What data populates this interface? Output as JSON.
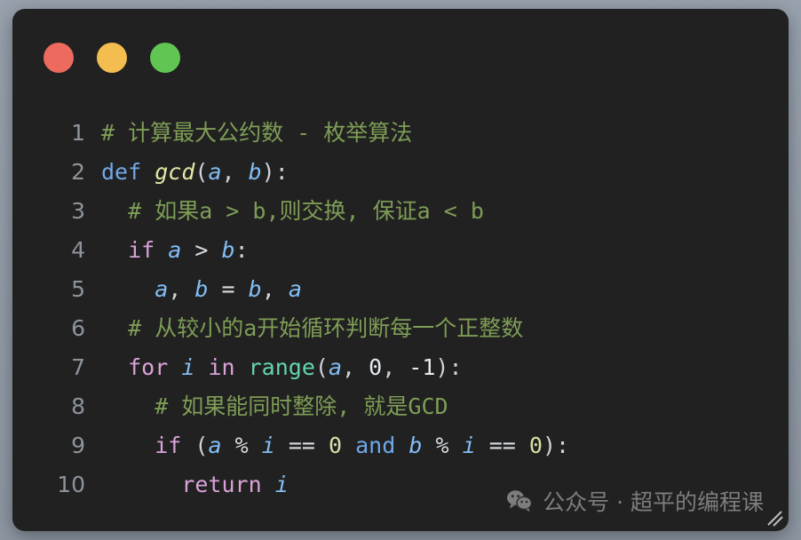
{
  "window": {
    "background_color": "#212121",
    "page_background_color": "#8b95a1",
    "traffic_lights": [
      {
        "name": "close",
        "color": "#ec6a5e"
      },
      {
        "name": "minimize",
        "color": "#f4bd4f"
      },
      {
        "name": "zoom",
        "color": "#61c554"
      }
    ]
  },
  "editor": {
    "language": "python",
    "line_number_color": "#8d949c",
    "lines": [
      {
        "num": "1",
        "text": "# 计算最大公约数 - 枚举算法"
      },
      {
        "num": "2",
        "text": "def gcd(a, b):"
      },
      {
        "num": "3",
        "text": "  # 如果a > b,则交换, 保证a < b"
      },
      {
        "num": "4",
        "text": "  if a > b:"
      },
      {
        "num": "5",
        "text": "    a, b = b, a"
      },
      {
        "num": "6",
        "text": "  # 从较小的a开始循环判断每一个正整数"
      },
      {
        "num": "7",
        "text": "  for i in range(a, 0, -1):"
      },
      {
        "num": "8",
        "text": "    # 如果能同时整除, 就是GCD"
      },
      {
        "num": "9",
        "text": "    if (a % i == 0 and b % i == 0):"
      },
      {
        "num": "10",
        "text": "      return i"
      }
    ],
    "tokens": {
      "l1": [
        {
          "t": "# 计算最大公约数 - 枚举算法",
          "c": "t-comment"
        }
      ],
      "l2": [
        {
          "t": "def",
          "c": "t-def"
        },
        {
          "t": " ",
          "c": "t-punc"
        },
        {
          "t": "gcd",
          "c": "t-fn ital"
        },
        {
          "t": "(",
          "c": "t-punc"
        },
        {
          "t": "a",
          "c": "t-var ital"
        },
        {
          "t": ", ",
          "c": "t-punc"
        },
        {
          "t": "b",
          "c": "t-var ital"
        },
        {
          "t": "):",
          "c": "t-punc"
        }
      ],
      "l3": [
        {
          "t": "  # 如果a > b,则交换, 保证a < b",
          "c": "t-comment"
        }
      ],
      "l4": [
        {
          "t": "  ",
          "c": "t-punc"
        },
        {
          "t": "if",
          "c": "t-keyword"
        },
        {
          "t": " ",
          "c": "t-punc"
        },
        {
          "t": "a",
          "c": "t-var ital"
        },
        {
          "t": " ",
          "c": "t-punc"
        },
        {
          "t": ">",
          "c": "t-op"
        },
        {
          "t": " ",
          "c": "t-punc"
        },
        {
          "t": "b",
          "c": "t-var ital"
        },
        {
          "t": ":",
          "c": "t-punc"
        }
      ],
      "l5": [
        {
          "t": "    ",
          "c": "t-punc"
        },
        {
          "t": "a",
          "c": "t-var ital"
        },
        {
          "t": ", ",
          "c": "t-punc"
        },
        {
          "t": "b",
          "c": "t-var ital"
        },
        {
          "t": " ",
          "c": "t-punc"
        },
        {
          "t": "=",
          "c": "t-op"
        },
        {
          "t": " ",
          "c": "t-punc"
        },
        {
          "t": "b",
          "c": "t-var ital"
        },
        {
          "t": ", ",
          "c": "t-punc"
        },
        {
          "t": "a",
          "c": "t-var ital"
        }
      ],
      "l6": [
        {
          "t": "  # 从较小的a开始循环判断每一个正整数",
          "c": "t-comment"
        }
      ],
      "l7": [
        {
          "t": "  ",
          "c": "t-punc"
        },
        {
          "t": "for",
          "c": "t-keyword"
        },
        {
          "t": " ",
          "c": "t-punc"
        },
        {
          "t": "i",
          "c": "t-var ital"
        },
        {
          "t": " ",
          "c": "t-punc"
        },
        {
          "t": "in",
          "c": "t-keyword"
        },
        {
          "t": " ",
          "c": "t-punc"
        },
        {
          "t": "range",
          "c": "t-builtin"
        },
        {
          "t": "(",
          "c": "t-punc"
        },
        {
          "t": "a",
          "c": "t-var ital"
        },
        {
          "t": ", ",
          "c": "t-punc"
        },
        {
          "t": "0",
          "c": "t-numw"
        },
        {
          "t": ", ",
          "c": "t-punc"
        },
        {
          "t": "-1",
          "c": "t-numw"
        },
        {
          "t": "):",
          "c": "t-punc"
        }
      ],
      "l8": [
        {
          "t": "    # 如果能同时整除, 就是GCD",
          "c": "t-comment"
        }
      ],
      "l9": [
        {
          "t": "    ",
          "c": "t-punc"
        },
        {
          "t": "if",
          "c": "t-keyword"
        },
        {
          "t": " ",
          "c": "t-punc"
        },
        {
          "t": "(",
          "c": "t-punc"
        },
        {
          "t": "a",
          "c": "t-var ital"
        },
        {
          "t": " ",
          "c": "t-punc"
        },
        {
          "t": "%",
          "c": "t-op"
        },
        {
          "t": " ",
          "c": "t-punc"
        },
        {
          "t": "i",
          "c": "t-var ital"
        },
        {
          "t": " ",
          "c": "t-punc"
        },
        {
          "t": "==",
          "c": "t-op"
        },
        {
          "t": " ",
          "c": "t-punc"
        },
        {
          "t": "0",
          "c": "t-num"
        },
        {
          "t": " ",
          "c": "t-punc"
        },
        {
          "t": "and",
          "c": "t-and"
        },
        {
          "t": " ",
          "c": "t-punc"
        },
        {
          "t": "b",
          "c": "t-var ital"
        },
        {
          "t": " ",
          "c": "t-punc"
        },
        {
          "t": "%",
          "c": "t-op"
        },
        {
          "t": " ",
          "c": "t-punc"
        },
        {
          "t": "i",
          "c": "t-var ital"
        },
        {
          "t": " ",
          "c": "t-punc"
        },
        {
          "t": "==",
          "c": "t-op"
        },
        {
          "t": " ",
          "c": "t-punc"
        },
        {
          "t": "0",
          "c": "t-num"
        },
        {
          "t": "):",
          "c": "t-punc"
        }
      ],
      "l10": [
        {
          "t": "      ",
          "c": "t-punc"
        },
        {
          "t": "return",
          "c": "t-keyword"
        },
        {
          "t": " ",
          "c": "t-punc"
        },
        {
          "t": "i",
          "c": "t-var ital"
        }
      ]
    }
  },
  "watermark": {
    "icon": "wechat-icon",
    "text": "公众号 · 超平的编程课",
    "color": "#8e8e8e"
  }
}
